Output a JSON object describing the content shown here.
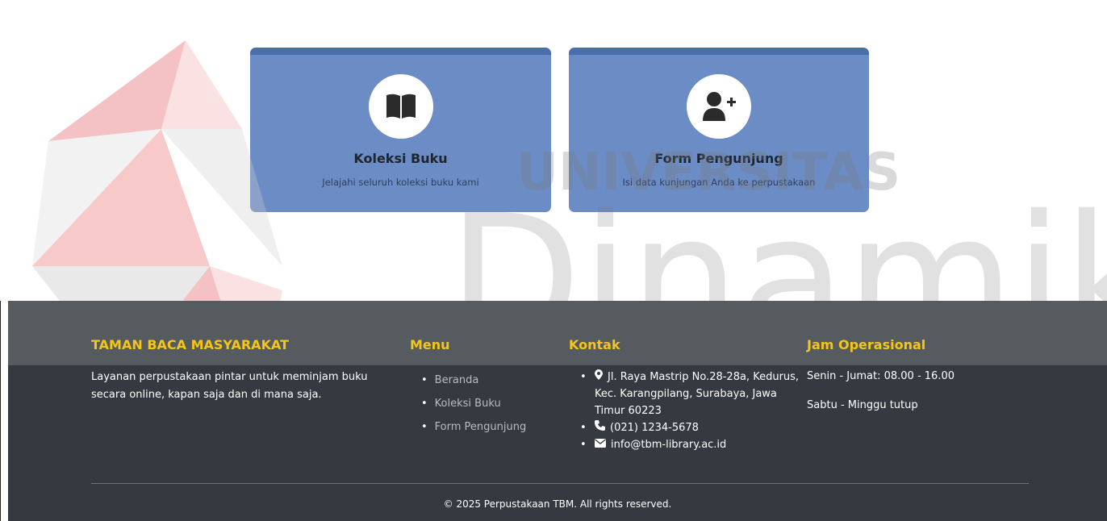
{
  "cards": [
    {
      "title": "Koleksi Buku",
      "description": "Jelajahi seluruh koleksi buku kami",
      "icon": "book-icon"
    },
    {
      "title": "Form Pengunjung",
      "description": "Isi data kunjungan Anda ke perpustakaan",
      "icon": "user-plus-icon"
    }
  ],
  "watermark": {
    "top_text": "UNIVERSITAS",
    "big_text": "Dinamika"
  },
  "footer": {
    "about": {
      "heading": "TAMAN BACA MASYARAKAT",
      "text": "Layanan perpustakaan pintar untuk meminjam buku secara online, kapan saja dan di mana saja."
    },
    "menu": {
      "heading": "Menu",
      "items": [
        "Beranda",
        "Koleksi Buku",
        "Form Pengunjung"
      ]
    },
    "contact": {
      "heading": "Kontak",
      "address": "Jl. Raya Mastrip No.28-28a, Kedurus, Kec. Karangpilang, Surabaya, Jawa Timur 60223",
      "phone": "(021) 1234-5678",
      "email": "info@tbm-library.ac.id"
    },
    "hours": {
      "heading": "Jam Operasional",
      "weekday": "Senin - Jumat: 08.00 - 16.00",
      "weekend": "Sabtu - Minggu tutup"
    },
    "copyright": "© 2025 Perpustakaan TBM. All rights reserved."
  },
  "colors": {
    "accent": "#f5c518",
    "card": "#6b8cc4",
    "card_top": "#4a6eab",
    "footer": "#343a40"
  }
}
